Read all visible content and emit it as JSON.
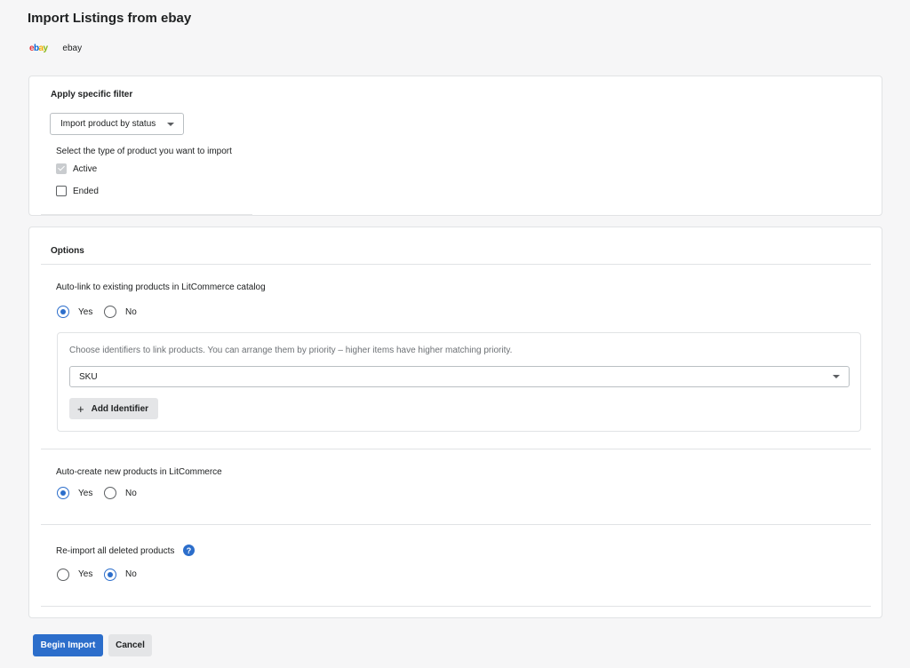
{
  "page": {
    "title": "Import Listings from ebay"
  },
  "channel": {
    "logo": {
      "e": "e",
      "b": "b",
      "a": "a",
      "y": "y"
    },
    "name": "ebay"
  },
  "filter": {
    "heading": "Apply specific filter",
    "dropdown_value": "Import product by status",
    "prompt": "Select the type of product you want to import",
    "statuses": [
      {
        "label": "Active",
        "checked": true
      },
      {
        "label": "Ended",
        "checked": false
      }
    ]
  },
  "options": {
    "heading": "Options",
    "auto_link": {
      "label": "Auto-link to existing products in LitCommerce catalog",
      "yes": "Yes",
      "no": "No",
      "selected": "Yes",
      "identifiers_hint": "Choose identifiers to link products. You can arrange them by priority – higher items have higher matching priority.",
      "identifier_value": "SKU",
      "add_identifier": "Add Identifier"
    },
    "auto_create": {
      "label": "Auto-create new products in LitCommerce",
      "yes": "Yes",
      "no": "No",
      "selected": "Yes"
    },
    "reimport": {
      "label": "Re-import all deleted products",
      "help": "?",
      "yes": "Yes",
      "no": "No",
      "selected": "No"
    }
  },
  "actions": {
    "begin": "Begin Import",
    "cancel": "Cancel"
  },
  "colors": {
    "accent": "#2c6ecb",
    "background": "#f6f6f7"
  }
}
